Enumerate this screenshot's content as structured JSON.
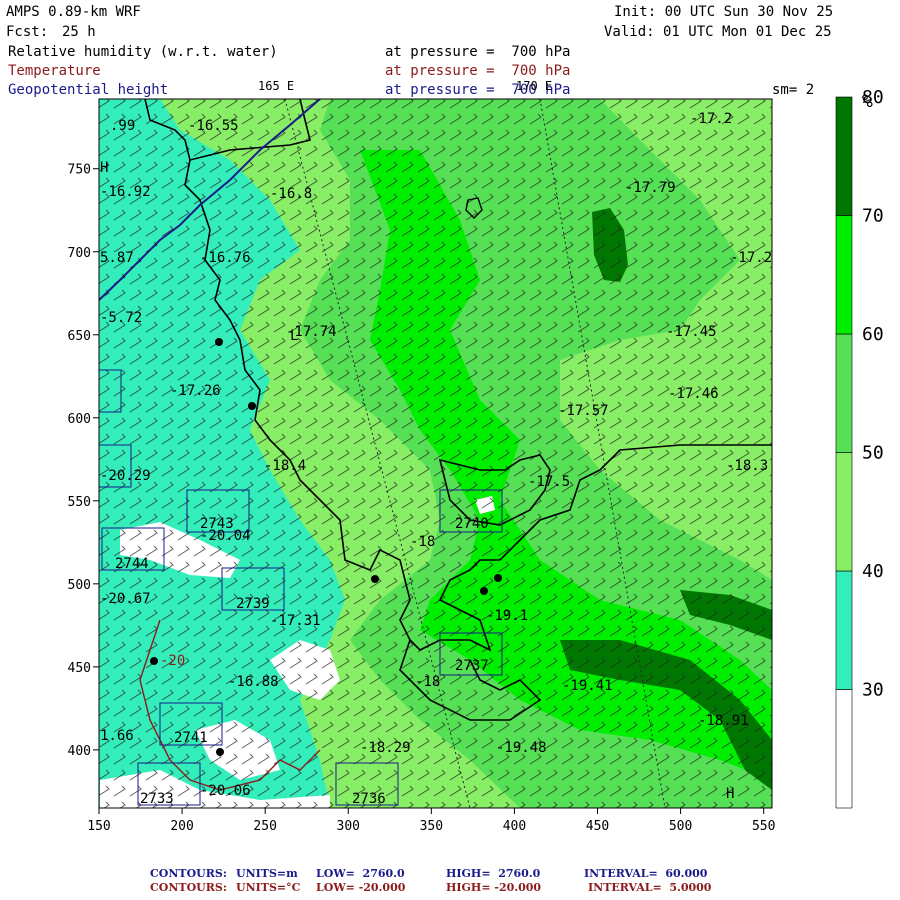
{
  "header": {
    "model": "AMPS 0.89-km WRF",
    "fcst_label": "Fcst:",
    "fcst_value": "25 h",
    "init": "Init: 00 UTC Sun 30 Nov 25",
    "valid": "Valid: 01 UTC Mon 01 Dec 25",
    "fields": [
      {
        "name": "Relative humidity (w.r.t. water)",
        "level": "at pressure =  700 hPa",
        "color": "#000000"
      },
      {
        "name": "Temperature",
        "level": "at pressure =  700 hPa",
        "color": "#8b1a1a"
      },
      {
        "name": "Geopotential height",
        "level": "at pressure =  700 hPa",
        "color": "#1a1a8b"
      }
    ],
    "lon_labels": [
      "165 E",
      "170 E"
    ],
    "smoothing": "sm= 2"
  },
  "colorbar": {
    "unit": "%",
    "levels": [
      "30",
      "40",
      "50",
      "60",
      "70",
      "80"
    ],
    "colors": [
      "#ffffff",
      "#33eebb",
      "#88ee66",
      "#55e055",
      "#00ee00",
      "#007700"
    ]
  },
  "axes": {
    "x_ticks": [
      "150",
      "200",
      "250",
      "300",
      "350",
      "400",
      "450",
      "500",
      "550"
    ],
    "y_ticks": [
      "400",
      "450",
      "500",
      "550",
      "600",
      "650",
      "700",
      "750"
    ]
  },
  "map_labels": [
    {
      "t": ".99",
      "c": "blk"
    },
    {
      "t": "-16.55",
      "c": "blk"
    },
    {
      "t": "-17.2",
      "c": "blk"
    },
    {
      "t": "H",
      "c": "blk"
    },
    {
      "t": "-16.92",
      "c": "blk"
    },
    {
      "t": "-16.8",
      "c": "blk"
    },
    {
      "t": "-17.79",
      "c": "blk"
    },
    {
      "t": "-16.76",
      "c": "blk"
    },
    {
      "t": "-17.2",
      "c": "blk"
    },
    {
      "t": "5.87",
      "c": "blk"
    },
    {
      "t": "-17.74",
      "c": "blk"
    },
    {
      "t": "-17.45",
      "c": "blk"
    },
    {
      "t": "-5.72",
      "c": "blk"
    },
    {
      "t": "-17.26",
      "c": "blk"
    },
    {
      "t": "-17.46",
      "c": "blk"
    },
    {
      "t": "-17.57",
      "c": "blk"
    },
    {
      "t": "-18.4",
      "c": "blk"
    },
    {
      "t": "-18.3",
      "c": "blk"
    },
    {
      "t": "-20.29",
      "c": "blk"
    },
    {
      "t": "-17.5",
      "c": "blk"
    },
    {
      "t": "2743",
      "c": "blk"
    },
    {
      "t": "-20.04",
      "c": "blk"
    },
    {
      "t": "2740",
      "c": "blk"
    },
    {
      "t": "-18",
      "c": "blk"
    },
    {
      "t": "2744",
      "c": "blk"
    },
    {
      "t": "-20.67",
      "c": "blk"
    },
    {
      "t": "2739",
      "c": "blk"
    },
    {
      "t": "-17.31",
      "c": "blk"
    },
    {
      "t": "-19.1",
      "c": "blk"
    },
    {
      "t": "2737",
      "c": "blk"
    },
    {
      "t": "-18",
      "c": "blk"
    },
    {
      "t": "-19.41",
      "c": "blk"
    },
    {
      "t": "-16.88",
      "c": "blk"
    },
    {
      "t": "-18.91",
      "c": "blk"
    },
    {
      "t": "2741",
      "c": "blk"
    },
    {
      "t": "-18.29",
      "c": "blk"
    },
    {
      "t": "-19.48",
      "c": "blk"
    },
    {
      "t": "1.66",
      "c": "blk"
    },
    {
      "t": "2733",
      "c": "blk"
    },
    {
      "t": "-20.06",
      "c": "blk"
    },
    {
      "t": "2736",
      "c": "blk"
    },
    {
      "t": "H",
      "c": "blk"
    },
    {
      "t": "L",
      "c": "blk"
    },
    {
      "t": "-20",
      "c": "red"
    }
  ],
  "footer": [
    {
      "label": "CONTOURS:",
      "units": "UNITS=m",
      "low": "LOW=  2760.0",
      "high": "HIGH=  2760.0",
      "interval": "INTERVAL=  60.000",
      "color": "#1a1a8b"
    },
    {
      "label": "CONTOURS:",
      "units": "UNITS=°C",
      "low": "LOW= -20.000",
      "high": "HIGH= -20.000",
      "interval": "INTERVAL=  5.0000",
      "color": "#8b1a1a"
    }
  ]
}
